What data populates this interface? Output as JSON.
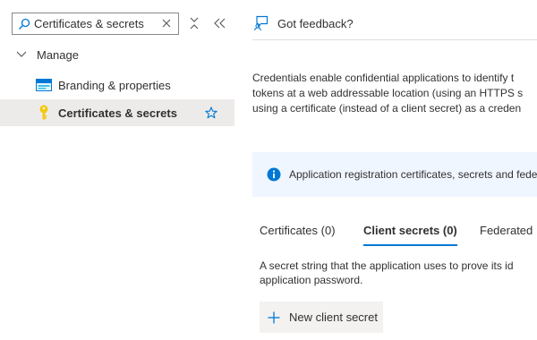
{
  "nav": {
    "search": {
      "value": "Certificates & secrets",
      "placeholder": "Search"
    },
    "group_label": "Manage",
    "items": [
      {
        "label": "Branding & properties",
        "icon": "branding-icon"
      },
      {
        "label": "Certificates & secrets",
        "icon": "key-icon",
        "selected": true
      }
    ]
  },
  "content": {
    "feedback_label": "Got feedback?",
    "description_lines": [
      "Credentials enable confidential applications to identify t",
      "tokens at a web addressable location (using an HTTPS s",
      "using a certificate (instead of a client secret) as a creden"
    ],
    "info_text": "Application registration certificates, secrets and fede",
    "tabs": [
      {
        "label": "Certificates (0)",
        "active": false
      },
      {
        "label": "Client secrets (0)",
        "active": true
      },
      {
        "label": "Federated",
        "active": false
      }
    ],
    "secret_description_lines": [
      "A secret string that the application uses to prove its id",
      "application password."
    ],
    "new_secret_label": "New client secret"
  },
  "colors": {
    "accent": "#0078d4",
    "selected_bg": "#edebe9",
    "info_bg": "#f0f6ff",
    "key_yellow": "#f2c811",
    "branding_blue": "#40c0e8"
  }
}
